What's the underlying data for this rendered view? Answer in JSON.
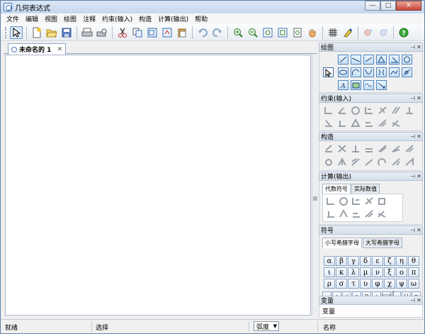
{
  "window": {
    "title": "几何表达式",
    "min": "—",
    "max": "□",
    "close": "✕"
  },
  "menu": [
    "文件",
    "编辑",
    "视图",
    "绘图",
    "注释",
    "约束(输入)",
    "构造",
    "计算(输出)",
    "帮助"
  ],
  "toolbar": {
    "groups": [
      [
        "select-tool-icon"
      ],
      [
        "new-file-icon",
        "open-file-icon",
        "save-file-icon"
      ],
      [
        "print-icon",
        "print-preview-icon"
      ],
      [
        "cut-icon",
        "copy-icon",
        "copy-as-icon",
        "paste-special-icon",
        "paste-icon"
      ],
      [
        "undo-icon",
        "redo-icon"
      ],
      [
        "zoom-in-icon",
        "zoom-out-icon",
        "zoom-fit-icon",
        "zoom-window-icon",
        "zoom-page-icon",
        "pan-hand-icon"
      ],
      [
        "grid-icon",
        "pen-style-icon"
      ],
      [
        "animate-icon",
        "unanimate-icon"
      ],
      [
        "help-icon"
      ]
    ]
  },
  "document": {
    "tab_label": "未命名的 1",
    "tab_close": "✕"
  },
  "status": {
    "left": "就绪",
    "middle": "选择",
    "angle_mode": "弧度",
    "right": "名称"
  },
  "panels": {
    "draw": {
      "title": "绘图"
    },
    "constraints": {
      "title": "约束(输入)"
    },
    "construct": {
      "title": "构造"
    },
    "calculate": {
      "title": "计算(输出)",
      "tabs": [
        "代数符号",
        "实际数值"
      ]
    },
    "symbols": {
      "title": "符号",
      "tabs": [
        "小写希腊字母",
        "大写希腊字母"
      ],
      "greek": [
        "α",
        "β",
        "γ",
        "δ",
        "ε",
        "ζ",
        "η",
        "θ",
        "ι",
        "κ",
        "λ",
        "μ",
        "ν",
        "ξ",
        "ο",
        "π",
        "ρ",
        "σ",
        "τ",
        "υ",
        "φ",
        "χ",
        "ψ",
        "ω"
      ],
      "operators": [
        "·",
        "÷",
        "√",
        "∎",
        "∏",
        "⟂",
        "(□)",
        "|□|",
        "{}",
        "π"
      ]
    },
    "variables": {
      "title": "变量",
      "header": "变量"
    }
  },
  "pin_glyph": "⊣",
  "close_glyph": "✕",
  "colors": {
    "accent": "#3a6fb0",
    "panel_header": "#d5dfeb",
    "icon_blue": "#4f87c2"
  }
}
